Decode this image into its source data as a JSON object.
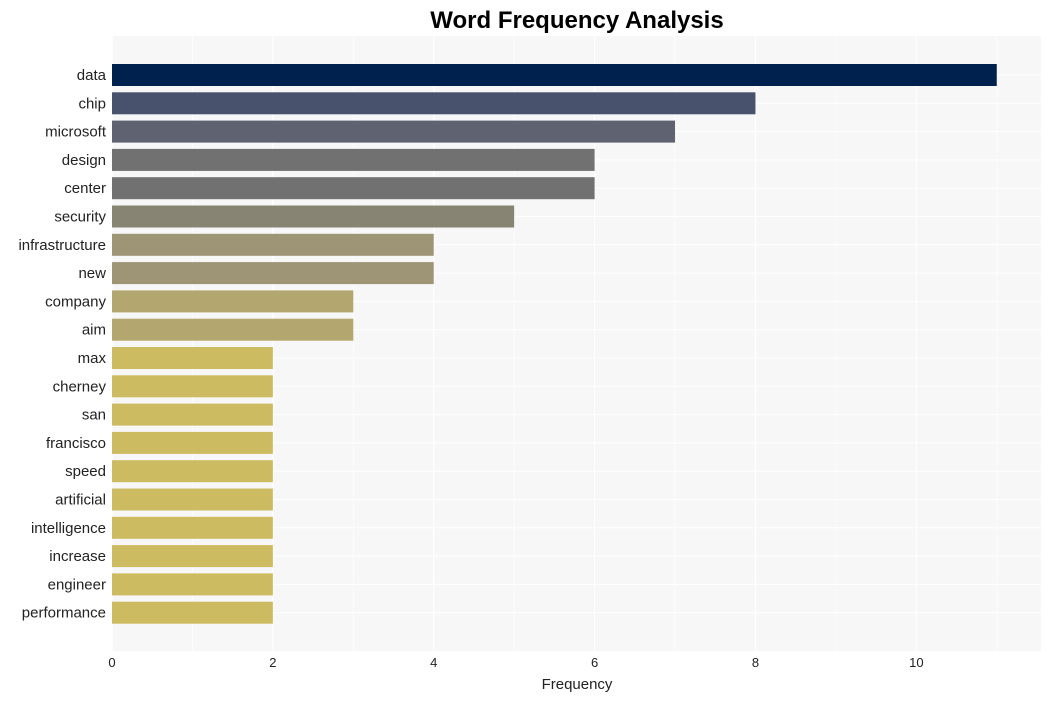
{
  "chart_data": {
    "type": "bar",
    "orientation": "horizontal",
    "title": "Word Frequency Analysis",
    "xlabel": "Frequency",
    "ylabel": "",
    "xlim": [
      0,
      11.55
    ],
    "xticks": [
      0,
      2,
      4,
      6,
      8,
      10
    ],
    "grid": true,
    "legend": "none",
    "categories": [
      "data",
      "chip",
      "microsoft",
      "design",
      "center",
      "security",
      "infrastructure",
      "new",
      "company",
      "aim",
      "max",
      "cherney",
      "san",
      "francisco",
      "speed",
      "artificial",
      "intelligence",
      "increase",
      "engineer",
      "performance"
    ],
    "values": [
      11,
      8,
      7,
      6,
      6,
      5,
      4,
      4,
      3,
      3,
      2,
      2,
      2,
      2,
      2,
      2,
      2,
      2,
      2,
      2
    ],
    "colors": [
      "#00204d",
      "#49526c",
      "#5f6270",
      "#717171",
      "#717171",
      "#878473",
      "#9e9476",
      "#9e9476",
      "#b3a66f",
      "#b3a66f",
      "#cdbb62",
      "#cdbb62",
      "#cdbb62",
      "#cdbb62",
      "#cdbb62",
      "#cdbb62",
      "#cdbb62",
      "#cdbb62",
      "#cdbb62",
      "#cdbb62"
    ],
    "plot_background": "#f7f7f7",
    "grid_color": "#ffffff"
  }
}
